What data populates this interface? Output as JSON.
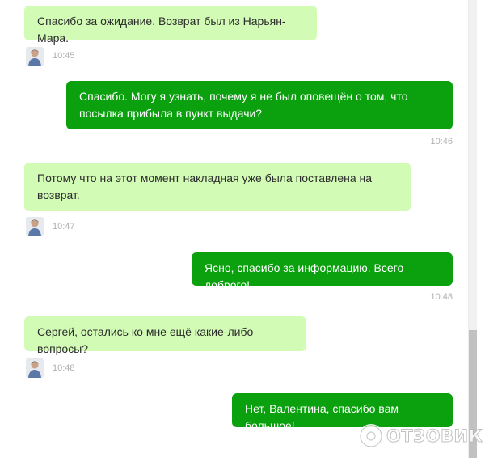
{
  "messages": [
    {
      "side": "in",
      "text": "Спасибо за ожидание. Возврат был из Нарьян-Мара.",
      "time": "10:45"
    },
    {
      "side": "out",
      "text": "Спасибо. Могу я узнать, почему я не был оповещён о том, что посылка прибыла в пункт выдачи?",
      "time": "10:46"
    },
    {
      "side": "in",
      "text": "Потому что на этот момент накладная уже была поставлена на возврат.",
      "time": "10:47"
    },
    {
      "side": "out",
      "text": "Ясно, спасибо за информацию. Всего доброго!",
      "time": "10:48"
    },
    {
      "side": "in",
      "text": "Сергей, остались ко мне ещё какие-либо вопросы?",
      "time": "10:48"
    },
    {
      "side": "out",
      "text": "Нет, Валентина, спасибо вам большое!"
    }
  ],
  "watermark": {
    "text": "ОТЗОВИК"
  },
  "colors": {
    "incoming_bubble": "#d2fbb6",
    "outgoing_bubble": "#0aa00e",
    "timestamp": "#b0b0b0"
  }
}
